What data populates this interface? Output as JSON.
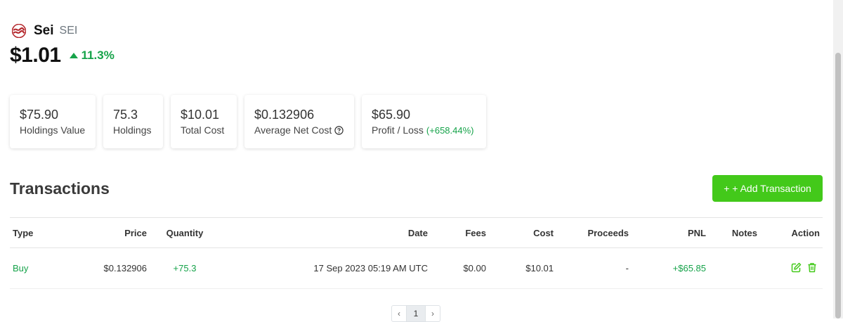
{
  "coin": {
    "name": "Sei",
    "symbol": "SEI",
    "price": "$1.01",
    "change": "11.3%"
  },
  "stats": [
    {
      "value": "$75.90",
      "label": "Holdings Value"
    },
    {
      "value": "75.3",
      "label": "Holdings"
    },
    {
      "value": "$10.01",
      "label": "Total Cost"
    },
    {
      "value": "$0.132906",
      "label": "Average Net Cost"
    },
    {
      "value": "$65.90",
      "label": "Profit / Loss",
      "extra": "(+658.44%)"
    }
  ],
  "transactions": {
    "title": "Transactions",
    "add_label": "+ + Add Transaction",
    "headers": [
      "Type",
      "Price",
      "Quantity",
      "Date",
      "Fees",
      "Cost",
      "Proceeds",
      "PNL",
      "Notes",
      "Action"
    ],
    "rows": [
      {
        "type": "Buy",
        "price": "$0.132906",
        "quantity": "+75.3",
        "date": "17 Sep 2023 05:19 AM UTC",
        "fees": "$0.00",
        "cost": "$10.01",
        "proceeds": "-",
        "pnl": "+$65.85",
        "notes": ""
      }
    ]
  },
  "pagination": {
    "prev": "‹",
    "current": "1",
    "next": "›"
  },
  "icons": {
    "logo": "sei-logo-icon",
    "trend": "caret-up-icon",
    "help": "question-circle-icon",
    "edit": "edit-icon",
    "delete": "trash-icon"
  },
  "colors": {
    "positive": "#16a34a",
    "button": "#43c91a",
    "logo": "#b5292e"
  }
}
